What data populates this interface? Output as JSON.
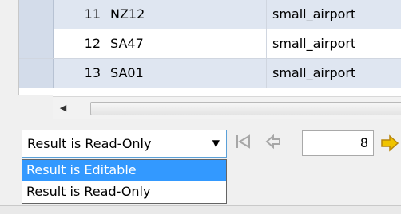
{
  "grid": {
    "rows": [
      {
        "num": "11",
        "ident": "NZ12",
        "type": "small_airport"
      },
      {
        "num": "12",
        "ident": "SA47",
        "type": "small_airport"
      },
      {
        "num": "13",
        "ident": "SA01",
        "type": "small_airport"
      }
    ]
  },
  "scrollbar": {
    "left_arrow": "◀"
  },
  "result_mode": {
    "selected": "Result is Read-Only",
    "arrow": "▼",
    "options": [
      "Result is Editable",
      "Result is Read-Only"
    ],
    "highlighted": "Result is Editable"
  },
  "pager": {
    "first_icon": "first-page-icon",
    "prev_icon": "prev-page-icon",
    "page": "8",
    "next_icon": "next-page-icon",
    "next_color": "#f0c400"
  },
  "colors": {
    "row_odd": "#dfe6f1",
    "selection": "#3399ff"
  }
}
